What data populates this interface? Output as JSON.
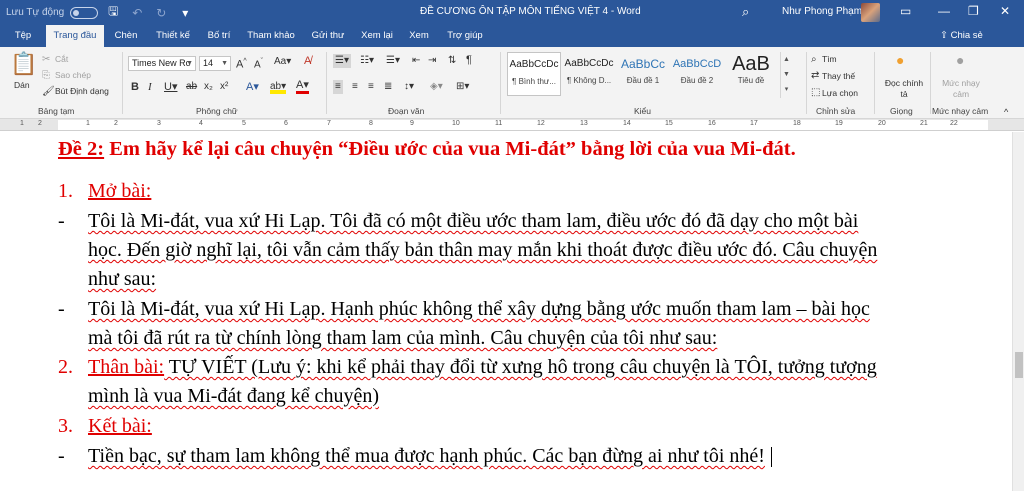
{
  "titlebar": {
    "autosave_label": "Lưu Tự động",
    "doc_title": "ĐỀ CƯƠNG ÔN TẬP MÔN TIẾNG VIỆT 4  -  Word",
    "user_name": "Như Phong Phạm",
    "icons": [
      "save-icon",
      "undo-icon",
      "redo-icon",
      "customize-qat-icon",
      "search-icon",
      "ribbon-display-icon",
      "minimize-icon",
      "restore-icon",
      "close-icon"
    ]
  },
  "tabs": [
    "Tệp",
    "Trang đầu",
    "Chèn",
    "Thiết kế",
    "Bố trí",
    "Tham khảo",
    "Gửi thư",
    "Xem lại",
    "Xem",
    "Trợ giúp"
  ],
  "active_tab": "Trang đầu",
  "share_label": "Chia sẻ",
  "ribbon": {
    "clipboard": {
      "paste": "Dán",
      "cut": "Cắt",
      "copy": "Sao chép",
      "format_painter": "Bút Định dạng",
      "group": "Bảng tạm"
    },
    "font": {
      "name": "Times New Ro",
      "size": "14",
      "group": "Phông chữ"
    },
    "paragraph": {
      "group": "Đoạn văn"
    },
    "styles": {
      "group": "Kiểu",
      "items": [
        {
          "sample": "AaBbCcDc",
          "name": "¶ Bình thư..."
        },
        {
          "sample": "AaBbCcDc",
          "name": "¶ Không D..."
        },
        {
          "sample": "AaBbCc",
          "name": "Đầu đề 1"
        },
        {
          "sample": "AaBbCcD",
          "name": "Đầu đề 2"
        },
        {
          "sample": "AaB",
          "name": "Tiêu đề"
        }
      ]
    },
    "editing": {
      "find": "Tìm",
      "replace": "Thay thế",
      "select": "Lựa chọn",
      "group": "Chỉnh sửa"
    },
    "voice": {
      "dictate": "Đọc chính tả",
      "group": "Giọng"
    },
    "sensitivity": {
      "label": "Mức nhạy cảm",
      "group": "Mức nhạy cảm"
    }
  },
  "ruler_numbers": [
    "1",
    "2",
    "1",
    "2",
    "3",
    "4",
    "5",
    "6",
    "7",
    "8",
    "9",
    "10",
    "11",
    "12",
    "13",
    "14",
    "15",
    "16",
    "17",
    "18",
    "19",
    "20",
    "21",
    "22"
  ],
  "document": {
    "heading_prefix": "Đề 2:",
    "heading_rest": " Em hãy kể lại câu chuyện “Điều ước của vua Mi-đát” bằng lời của vua Mi-đát.",
    "sec1_num": "1.",
    "sec1_title": "Mở bài:",
    "bullet": "-",
    "p1_l1": "Tôi là Mi-đát, vua xứ Hi Lạp. Tôi đã có một điều ước tham lam, điều ước đó đã dạy cho một bài",
    "p1_l2": "học. Đến giờ nghĩ lại, tôi vẫn cảm thấy bản thân may mắn khi thoát được điều ước đó. Câu chuyện",
    "p1_l3": "như sau:",
    "p2_l1": "Tôi là Mi-đát, vua xứ Hi Lạp. Hạnh phúc không thể xây dựng bằng ước muốn tham lam – bài học",
    "p2_l2": "mà tôi đã rút ra từ chính lòng tham lam của mình. Câu chuyện của tôi như sau:",
    "sec2_num": "2.",
    "sec2_title": "Thân bài:",
    "sec2_text": " TỰ VIẾT (Lưu ý: khi kể phải thay đổi từ xưng hô trong câu chuyện là TÔI, tưởng tượng",
    "sec2_l2": "mình là vua Mi-đát đang kể chuyện)",
    "sec3_num": "3.",
    "sec3_title": "Kết bài:",
    "p3_l1": "Tiền bạc, sự tham lam không thể mua được hạnh phúc. Các bạn đừng ai như tôi nhé!"
  }
}
